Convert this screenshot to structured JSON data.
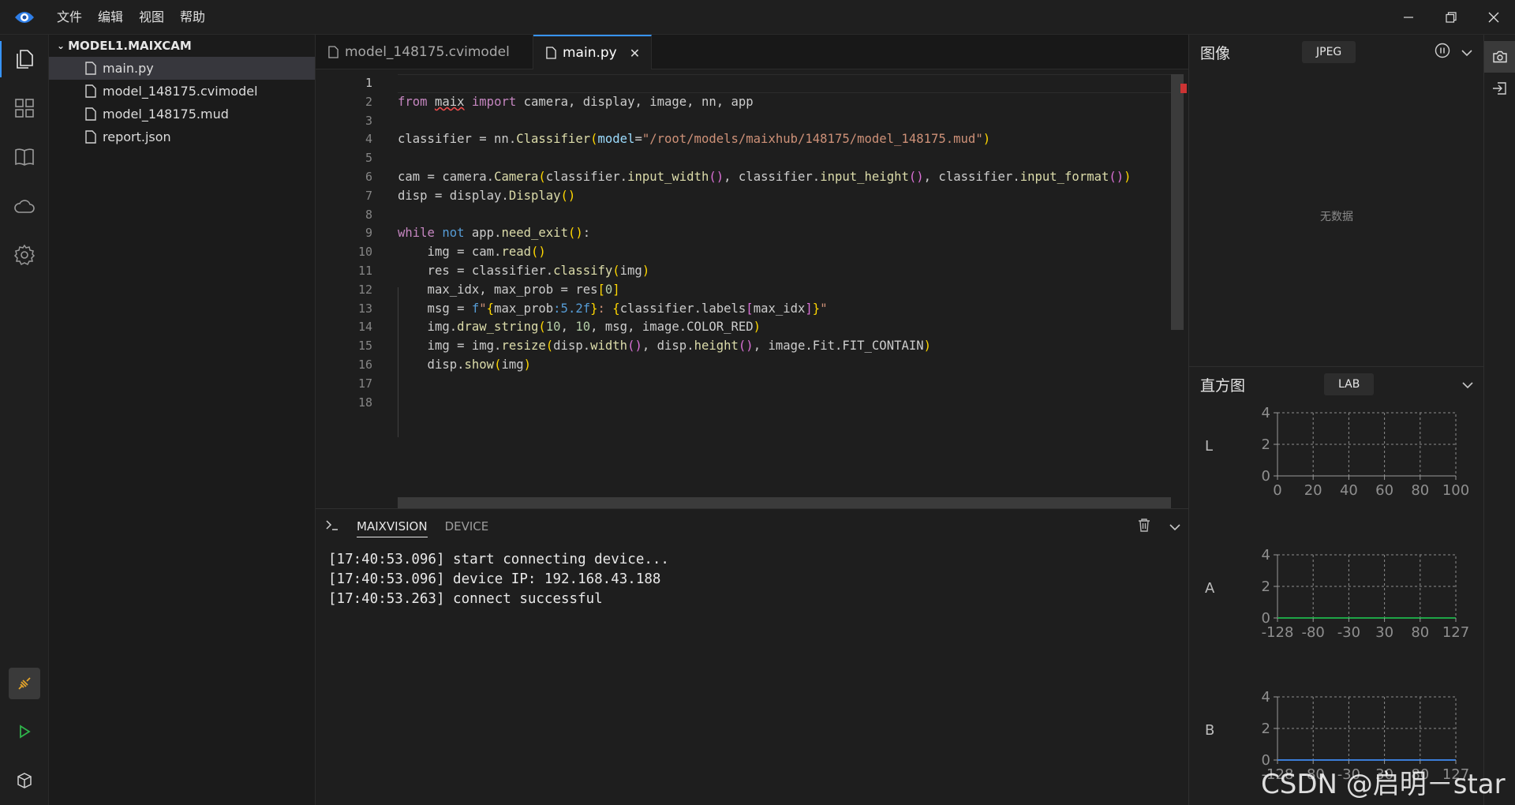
{
  "menu": {
    "file": "文件",
    "edit": "编辑",
    "view": "视图",
    "help": "帮助"
  },
  "explorer": {
    "root": "MODEL1.MAIXCAM",
    "files": [
      "main.py",
      "model_148175.cvimodel",
      "model_148175.mud",
      "report.json"
    ]
  },
  "tabs": [
    {
      "label": "model_148175.cvimodel"
    },
    {
      "label": "main.py"
    }
  ],
  "editor": {
    "line_numbers": [
      "1",
      "2",
      "3",
      "4",
      "5",
      "6",
      "7",
      "8",
      "9",
      "10",
      "11",
      "12",
      "13",
      "14",
      "15",
      "16",
      "17",
      "18"
    ]
  },
  "panel": {
    "tabs": [
      "MAIXVISION",
      "DEVICE"
    ],
    "log": [
      "[17:40:53.096] start connecting device...",
      "[17:40:53.096] device IP: 192.168.43.188",
      "[17:40:53.263] connect successful"
    ]
  },
  "image_panel": {
    "title": "图像",
    "format": "JPEG",
    "empty_text": "无数据"
  },
  "histogram_panel": {
    "title": "直方图",
    "mode": "LAB",
    "channels": [
      {
        "label": "L",
        "xticks": [
          "0",
          "20",
          "40",
          "60",
          "80",
          "100"
        ],
        "yticks": [
          "4",
          "2",
          "0"
        ]
      },
      {
        "label": "A",
        "xticks": [
          "-128",
          "-80",
          "-30",
          "30",
          "80",
          "127"
        ],
        "yticks": [
          "4",
          "2",
          "0"
        ]
      },
      {
        "label": "B",
        "xticks": [
          "-128",
          "-80",
          "-30",
          "30",
          "80",
          "127"
        ],
        "yticks": [
          "4",
          "2",
          "0"
        ]
      }
    ]
  },
  "colors": {
    "accent": "#3794ff",
    "green": "#1ea446",
    "blue": "#3b7dd8"
  },
  "watermark": "CSDN @启明－star"
}
